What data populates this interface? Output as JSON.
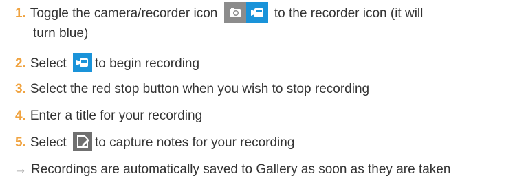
{
  "steps": [
    {
      "number": "1.",
      "text_before": "Toggle the camera/recorder icon",
      "text_after": "to the recorder icon (it will",
      "text_line2": "turn blue)"
    },
    {
      "number": "2.",
      "text_before": "Select",
      "text_after": "to begin recording"
    },
    {
      "number": "3.",
      "text": "Select the red stop button when you wish to stop recording"
    },
    {
      "number": "4.",
      "text": "Enter a title for your recording"
    },
    {
      "number": "5.",
      "text_before": "Select",
      "text_after": "to capture notes for your recording"
    }
  ],
  "note": {
    "arrow": "→",
    "text": "Recordings are automatically saved to Gallery as soon as they are taken"
  },
  "colors": {
    "number": "#f0a340",
    "recorder_blue": "#1a93d9",
    "camera_gray": "#8c8c8c",
    "notes_gray": "#707070",
    "text": "#333333"
  },
  "icons": [
    "camera-icon",
    "video-recorder-icon",
    "notes-icon"
  ]
}
